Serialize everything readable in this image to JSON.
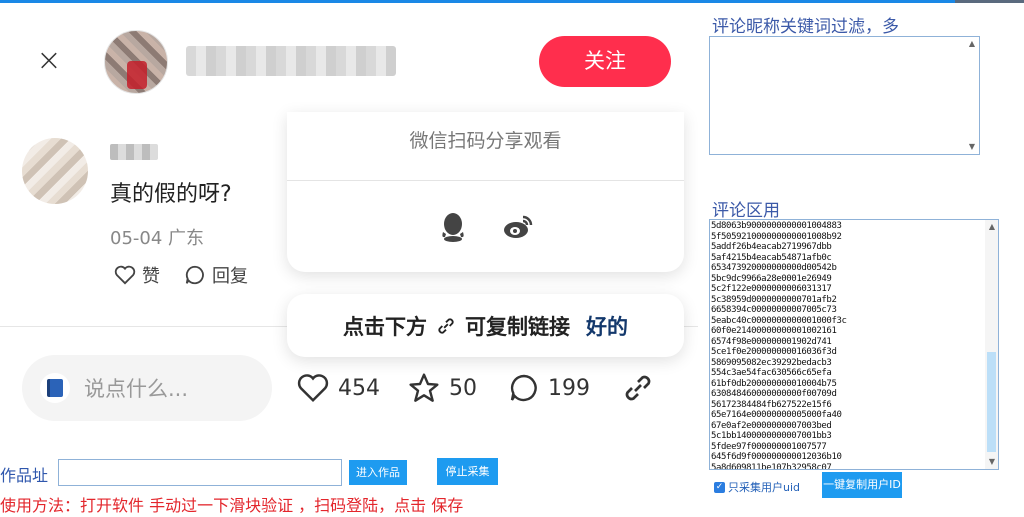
{
  "note": {
    "close_icon": "close-icon",
    "author_name": "blurred username",
    "follow_label": "关注",
    "comment": {
      "text": "真的假的呀?",
      "meta": "05-04 广东",
      "like_label": "赞",
      "reply_label": "回复"
    },
    "share": {
      "tip": "微信扫码分享观看"
    },
    "copy_tip": {
      "text": "点击下方",
      "text2": "可复制链接",
      "ok": "好的"
    },
    "say_placeholder": "说点什么...",
    "stats": {
      "likes": "454",
      "collects": "50",
      "comments": "199"
    },
    "accent_color": "#ff2e4d"
  },
  "tool": {
    "filter_label": "评论昵称关键词过滤，多",
    "comment_label": "评论区用",
    "comment_ids": [
      "5d8063b9000000000001004883",
      "5f505921000000000001008b92",
      "5addf26b4eacab2719967dbb",
      "5af4215b4eacab54871afb0c",
      "653473920000000000d00542b",
      "5bc9dc9966a28e0001e26949",
      "5c2f122e0000000006031317",
      "5c38959d0000000000701afb2",
      "6658394c00000000007005c73",
      "5eabc40c0000000000001000f3c",
      "60f0e21400000000001002161",
      "6574f98e000000001902d741",
      "5ce1f0e200000000016036f3d",
      "5869095082ec39292bedacb3",
      "554c3ae54fac630566c65efa",
      "61bf0db200000000010004b75",
      "630848460000000000f00709d",
      "56172384484fb627522e15f6",
      "65e7164e00000000005000fa40",
      "67e0af2e0000000007003bed",
      "5c1bb1400000000007001bb3",
      "5fdee97f000000001007577",
      "645f6d9f000000000012036b10",
      "5a8d609811be107b32958c07"
    ],
    "uid_only_label": "只采集用户uid",
    "copy_ids_label": "一键复制用户ID",
    "url_label": "作品址",
    "url_value": "",
    "enter_label": "进入作品",
    "stop_label": "停止采集",
    "usage_text": "使用方法：打开软件 手动过一下滑块验证 ，扫码登陆，点击 保存"
  }
}
